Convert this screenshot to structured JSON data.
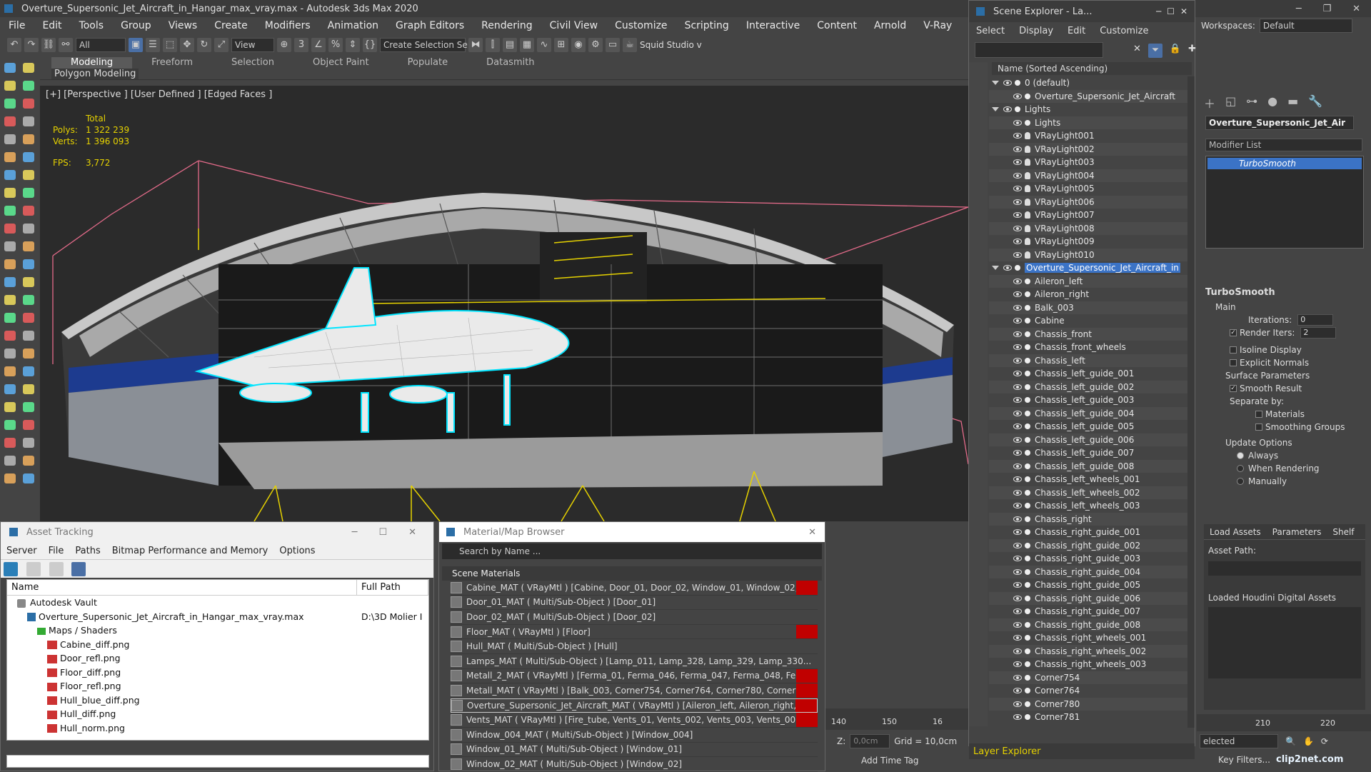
{
  "window": {
    "title": "Overture_Supersonic_Jet_Aircraft_in_Hangar_max_vray.max - Autodesk 3ds Max 2020"
  },
  "menu": [
    "File",
    "Edit",
    "Tools",
    "Group",
    "Views",
    "Create",
    "Modifiers",
    "Animation",
    "Graph Editors",
    "Rendering",
    "Civil View",
    "Customize",
    "Scripting",
    "Interactive",
    "Content",
    "Arnold",
    "V-Ray",
    "Me"
  ],
  "toolbar": {
    "filter": "All",
    "view": "View",
    "selection_set": "Create Selection Se",
    "squid": "Squid Studio v"
  },
  "workspaces": {
    "label": "Workspaces:",
    "value": "Default"
  },
  "ribbon": {
    "tabs": [
      "Modeling",
      "Freeform",
      "Selection",
      "Object Paint",
      "Populate",
      "Datasmith"
    ],
    "sub": "Polygon Modeling"
  },
  "viewport": {
    "label": "[+] [Perspective ] [User Defined ] [Edged Faces ]",
    "stats": {
      "total": "Total",
      "polys_label": "Polys:",
      "polys": "1 322 239",
      "verts_label": "Verts:",
      "verts": "1 396 093",
      "fps_label": "FPS:",
      "fps": "3,772"
    }
  },
  "scene_explorer": {
    "title": "Scene Explorer - La...",
    "menu": [
      "Select",
      "Display",
      "Edit",
      "Customize"
    ],
    "column": "Name (Sorted Ascending)",
    "rows": [
      {
        "label": "0 (default)",
        "type": "layer",
        "level": 0
      },
      {
        "label": "Overture_Supersonic_Jet_Aircraft",
        "type": "obj",
        "level": 1
      },
      {
        "label": "Lights",
        "type": "layer",
        "level": 0
      },
      {
        "label": "Lights",
        "type": "obj",
        "level": 1
      },
      {
        "label": "VRayLight001",
        "type": "light",
        "level": 1
      },
      {
        "label": "VRayLight002",
        "type": "light",
        "level": 1
      },
      {
        "label": "VRayLight003",
        "type": "light",
        "level": 1
      },
      {
        "label": "VRayLight004",
        "type": "light",
        "level": 1
      },
      {
        "label": "VRayLight005",
        "type": "light",
        "level": 1
      },
      {
        "label": "VRayLight006",
        "type": "light",
        "level": 1
      },
      {
        "label": "VRayLight007",
        "type": "light",
        "level": 1
      },
      {
        "label": "VRayLight008",
        "type": "light",
        "level": 1
      },
      {
        "label": "VRayLight009",
        "type": "light",
        "level": 1
      },
      {
        "label": "VRayLight010",
        "type": "light",
        "level": 1
      },
      {
        "label": "Overture_Supersonic_Jet_Aircraft_in",
        "type": "layer-sel",
        "level": 0
      },
      {
        "label": "Aileron_left",
        "type": "obj",
        "level": 1
      },
      {
        "label": "Aileron_right",
        "type": "obj",
        "level": 1
      },
      {
        "label": "Balk_003",
        "type": "obj",
        "level": 1
      },
      {
        "label": "Cabine",
        "type": "obj",
        "level": 1
      },
      {
        "label": "Chassis_front",
        "type": "obj",
        "level": 1
      },
      {
        "label": "Chassis_front_wheels",
        "type": "obj",
        "level": 1
      },
      {
        "label": "Chassis_left",
        "type": "obj",
        "level": 1
      },
      {
        "label": "Chassis_left_guide_001",
        "type": "obj",
        "level": 1
      },
      {
        "label": "Chassis_left_guide_002",
        "type": "obj",
        "level": 1
      },
      {
        "label": "Chassis_left_guide_003",
        "type": "obj",
        "level": 1
      },
      {
        "label": "Chassis_left_guide_004",
        "type": "obj",
        "level": 1
      },
      {
        "label": "Chassis_left_guide_005",
        "type": "obj",
        "level": 1
      },
      {
        "label": "Chassis_left_guide_006",
        "type": "obj",
        "level": 1
      },
      {
        "label": "Chassis_left_guide_007",
        "type": "obj",
        "level": 1
      },
      {
        "label": "Chassis_left_guide_008",
        "type": "obj",
        "level": 1
      },
      {
        "label": "Chassis_left_wheels_001",
        "type": "obj",
        "level": 1
      },
      {
        "label": "Chassis_left_wheels_002",
        "type": "obj",
        "level": 1
      },
      {
        "label": "Chassis_left_wheels_003",
        "type": "obj",
        "level": 1
      },
      {
        "label": "Chassis_right",
        "type": "obj",
        "level": 1
      },
      {
        "label": "Chassis_right_guide_001",
        "type": "obj",
        "level": 1
      },
      {
        "label": "Chassis_right_guide_002",
        "type": "obj",
        "level": 1
      },
      {
        "label": "Chassis_right_guide_003",
        "type": "obj",
        "level": 1
      },
      {
        "label": "Chassis_right_guide_004",
        "type": "obj",
        "level": 1
      },
      {
        "label": "Chassis_right_guide_005",
        "type": "obj",
        "level": 1
      },
      {
        "label": "Chassis_right_guide_006",
        "type": "obj",
        "level": 1
      },
      {
        "label": "Chassis_right_guide_007",
        "type": "obj",
        "level": 1
      },
      {
        "label": "Chassis_right_guide_008",
        "type": "obj",
        "level": 1
      },
      {
        "label": "Chassis_right_wheels_001",
        "type": "obj",
        "level": 1
      },
      {
        "label": "Chassis_right_wheels_002",
        "type": "obj",
        "level": 1
      },
      {
        "label": "Chassis_right_wheels_003",
        "type": "obj",
        "level": 1
      },
      {
        "label": "Corner754",
        "type": "obj",
        "level": 1
      },
      {
        "label": "Corner764",
        "type": "obj",
        "level": 1
      },
      {
        "label": "Corner780",
        "type": "obj",
        "level": 1
      },
      {
        "label": "Corner781",
        "type": "obj",
        "level": 1
      }
    ],
    "footer": "Layer Explorer"
  },
  "command_panel": {
    "object_name": "Overture_Supersonic_Jet_Air",
    "modifier_list": "Modifier List",
    "stack_item": "TurboSmooth",
    "turbosmooth": {
      "title": "TurboSmooth",
      "main": "Main",
      "iterations_label": "Iterations:",
      "iterations": "0",
      "render_iters_label": "Render Iters:",
      "render_iters": "2",
      "isoline": "Isoline Display",
      "explicit": "Explicit Normals",
      "surface": "Surface Parameters",
      "smooth": "Smooth Result",
      "separate": "Separate by:",
      "materials": "Materials",
      "smoothing": "Smoothing Groups",
      "update": "Update Options",
      "always": "Always",
      "when_rendering": "When Rendering",
      "manually": "Manually"
    },
    "hda": {
      "tabs": [
        "Load Assets",
        "Parameters",
        "Shelf"
      ],
      "asset_path": "Asset Path:",
      "loaded": "Loaded Houdini Digital Assets"
    }
  },
  "asset_tracking": {
    "title": "Asset Tracking",
    "menu": [
      "Server",
      "File",
      "Paths",
      "Bitmap Performance and Memory",
      "Options"
    ],
    "columns": [
      "Name",
      "Full Path"
    ],
    "rows": [
      {
        "name": "Autodesk Vault",
        "path": "",
        "icon": "vault",
        "indent": 1
      },
      {
        "name": "Overture_Supersonic_Jet_Aircraft_in_Hangar_max_vray.max",
        "path": "D:\\3D Molier I",
        "icon": "max",
        "indent": 2
      },
      {
        "name": "Maps / Shaders",
        "path": "",
        "icon": "map",
        "indent": 3
      },
      {
        "name": "Cabine_diff.png",
        "path": "",
        "icon": "png",
        "indent": 4
      },
      {
        "name": "Door_refl.png",
        "path": "",
        "icon": "png",
        "indent": 4
      },
      {
        "name": "Floor_diff.png",
        "path": "",
        "icon": "png",
        "indent": 4
      },
      {
        "name": "Floor_refl.png",
        "path": "",
        "icon": "png",
        "indent": 4
      },
      {
        "name": "Hull_blue_diff.png",
        "path": "",
        "icon": "png",
        "indent": 4
      },
      {
        "name": "Hull_diff.png",
        "path": "",
        "icon": "png",
        "indent": 4
      },
      {
        "name": "Hull_norm.png",
        "path": "",
        "icon": "png",
        "indent": 4
      }
    ]
  },
  "material_browser": {
    "title": "Material/Map Browser",
    "search": "Search by Name ...",
    "section": "Scene Materials",
    "rows": [
      {
        "label": "Cabine_MAT  ( VRayMtl )  [Cabine, Door_01, Door_02, Window_01, Window_02,...",
        "red": true
      },
      {
        "label": "Door_01_MAT  ( Multi/Sub-Object )  [Door_01]",
        "red": false
      },
      {
        "label": "Door_02_MAT  ( Multi/Sub-Object )  [Door_02]",
        "red": false
      },
      {
        "label": "Floor_MAT  ( VRayMtl )  [Floor]",
        "red": true
      },
      {
        "label": "Hull_MAT  ( Multi/Sub-Object )  [Hull]",
        "red": false
      },
      {
        "label": "Lamps_MAT  ( Multi/Sub-Object )  [Lamp_011, Lamp_328, Lamp_329, Lamp_330...",
        "red": false
      },
      {
        "label": "Metall_2_MAT  ( VRayMtl )  [Ferma_01, Ferma_046, Ferma_047, Ferma_048, Fer...",
        "red": true
      },
      {
        "label": "Metall_MAT  ( VRayMtl )  [Balk_003, Corner754, Corner764, Corner780, Corner78...",
        "red": true
      },
      {
        "label": "Overture_Supersonic_Jet_Aircraft_MAT  ( VRayMtl )  [Aileron_left, Aileron_right,...",
        "red": true
      },
      {
        "label": "Vents_MAT  ( VRayMtl )  [Fire_tube, Vents_01, Vents_002, Vents_003, Vents_00...",
        "red": true
      },
      {
        "label": "Window_004_MAT  ( Multi/Sub-Object )  [Window_004]",
        "red": false
      },
      {
        "label": "Window_01_MAT  ( Multi/Sub-Object )  [Window_01]",
        "red": false
      },
      {
        "label": "Window_02_MAT  ( Multi/Sub-Object )  [Window_02]",
        "red": false
      }
    ]
  },
  "timeline": {
    "ticks": [
      "140",
      "150",
      "16"
    ],
    "right_ticks": [
      "210",
      "220"
    ]
  },
  "status": {
    "z_label": "Z:",
    "z_value": "0,0cm",
    "grid": "Grid = 10,0cm",
    "add_time_tag": "Add Time Tag",
    "selected": "elected",
    "key_filters": "Key Filters..."
  },
  "watermark": "clip2net.com"
}
